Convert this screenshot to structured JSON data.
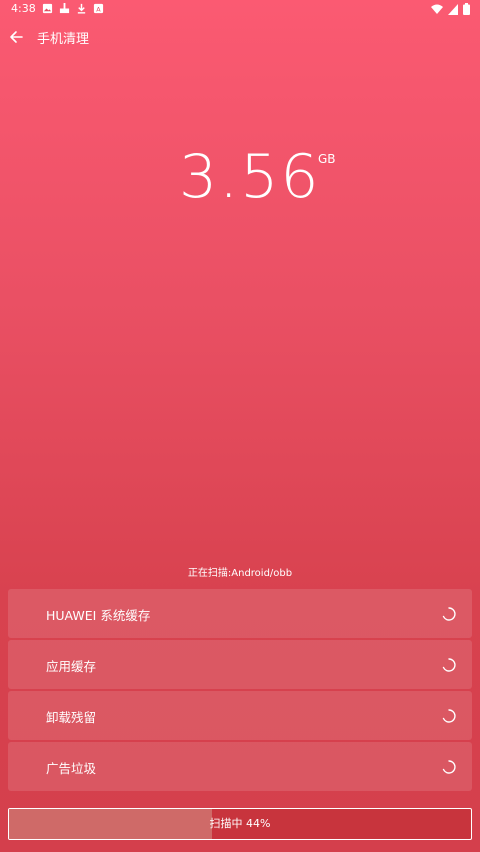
{
  "status": {
    "time": "4:38",
    "notification_icons": [
      "image-icon",
      "sweep-icon",
      "download-icon",
      "app-icon"
    ],
    "system_icons": [
      "wifi-icon",
      "signal-icon",
      "battery-icon"
    ]
  },
  "toolbar": {
    "title": "手机清理",
    "back_icon": "back-arrow-icon"
  },
  "summary": {
    "size_value": "3.56",
    "size_unit": "GB"
  },
  "scan": {
    "path_text": "正在扫描:Android/obb"
  },
  "categories": [
    {
      "label": "HUAWEI 系统缓存",
      "state_icon": "loading-spinner-icon"
    },
    {
      "label": "应用缓存",
      "state_icon": "loading-spinner-icon"
    },
    {
      "label": "卸载残留",
      "state_icon": "loading-spinner-icon"
    },
    {
      "label": "广告垃圾",
      "state_icon": "loading-spinner-icon"
    }
  ],
  "progress": {
    "label": "扫描中  44%",
    "fraction": 0.44
  },
  "colors": {
    "accent_top": "#fb5a72",
    "accent_bottom": "#d43f4c",
    "progress_fill": "#cf6a68"
  }
}
